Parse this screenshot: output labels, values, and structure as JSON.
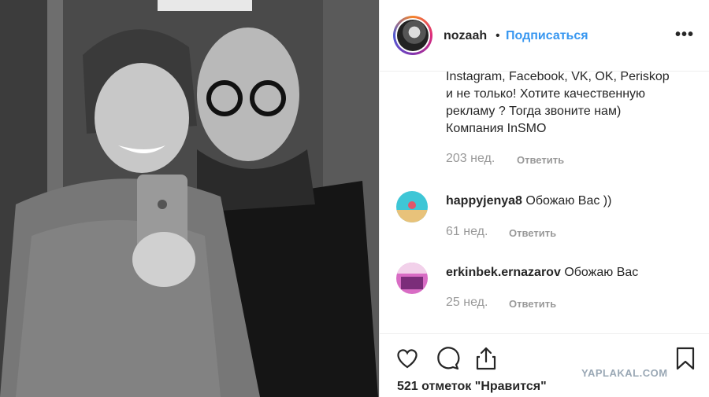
{
  "post": {
    "username": "nozaah",
    "separator": "•",
    "follow_label": "Подписаться",
    "more_label": "•••"
  },
  "caption": {
    "text": "Instagram, Facebook, VK, OK, Periskop и не только! Хотите качественную рекламу ? Тогда звоните нам) Компания InSMO",
    "time": "203 нед.",
    "reply_label": "Ответить"
  },
  "comments": [
    {
      "username": "happyjenya8",
      "text": "Обожаю Вас ))",
      "time": "61 нед.",
      "reply_label": "Ответить"
    },
    {
      "username": "erkinbek.ernazarov",
      "text": "Обожаю Вас",
      "time": "25 нед.",
      "reply_label": "Ответить"
    }
  ],
  "footer": {
    "likes_text": "521 отметок \"Нравится\""
  },
  "icons": [
    "heart-icon",
    "comment-icon",
    "share-icon",
    "bookmark-icon",
    "more-options-icon"
  ],
  "watermark": "YAPLAKAL.COM",
  "colors": {
    "accent": "#3897f0",
    "text": "#262626",
    "muted": "#999999"
  }
}
